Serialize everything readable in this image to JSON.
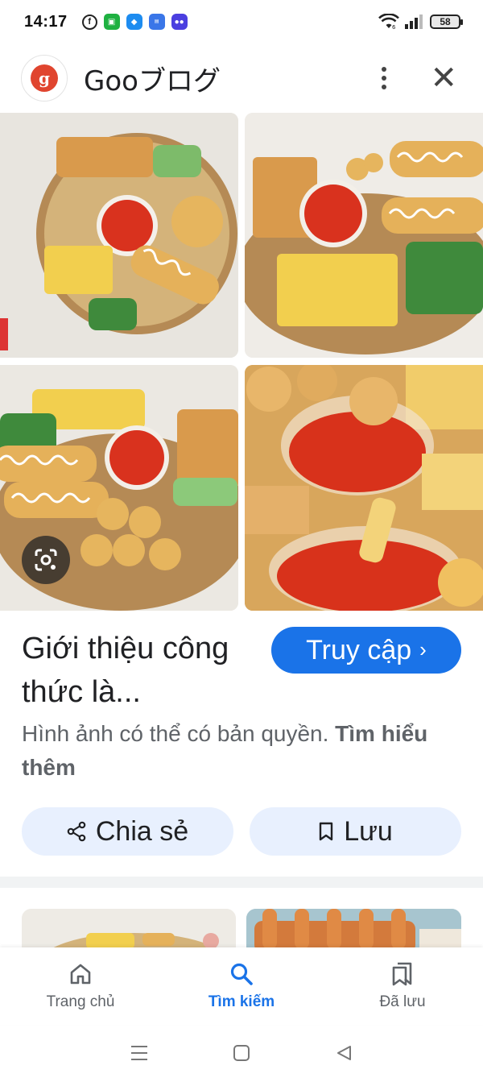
{
  "status_bar": {
    "time": "14:17",
    "battery": "58",
    "app_icons": [
      "facebook-icon",
      "app-green-icon",
      "app-blue-icon",
      "novel-toon-icon",
      "game-controller-icon"
    ]
  },
  "header": {
    "site_name": "Gooブログ",
    "more_icon": "more-vertical-icon",
    "close_icon": "close-icon"
  },
  "result": {
    "title": "Giới thiệu công thức là...",
    "visit_label": "Truy cập",
    "visit_chevron": "›",
    "copyright_text": "Hình ảnh có thể có bản quyền.",
    "learn_more": "Tìm hiểu thêm"
  },
  "actions": {
    "share_label": "Chia sẻ",
    "save_label": "Lưu"
  },
  "bottom_nav": {
    "items": [
      {
        "label": "Trang chủ",
        "icon": "home-icon",
        "active": false
      },
      {
        "label": "Tìm kiếm",
        "icon": "search-icon",
        "active": true
      },
      {
        "label": "Đã lưu",
        "icon": "bookmarks-icon",
        "active": false
      }
    ]
  },
  "colors": {
    "accent": "#1a73e8",
    "pill_bg": "#e8f0fe",
    "text_primary": "#202124",
    "text_secondary": "#5f6368"
  }
}
